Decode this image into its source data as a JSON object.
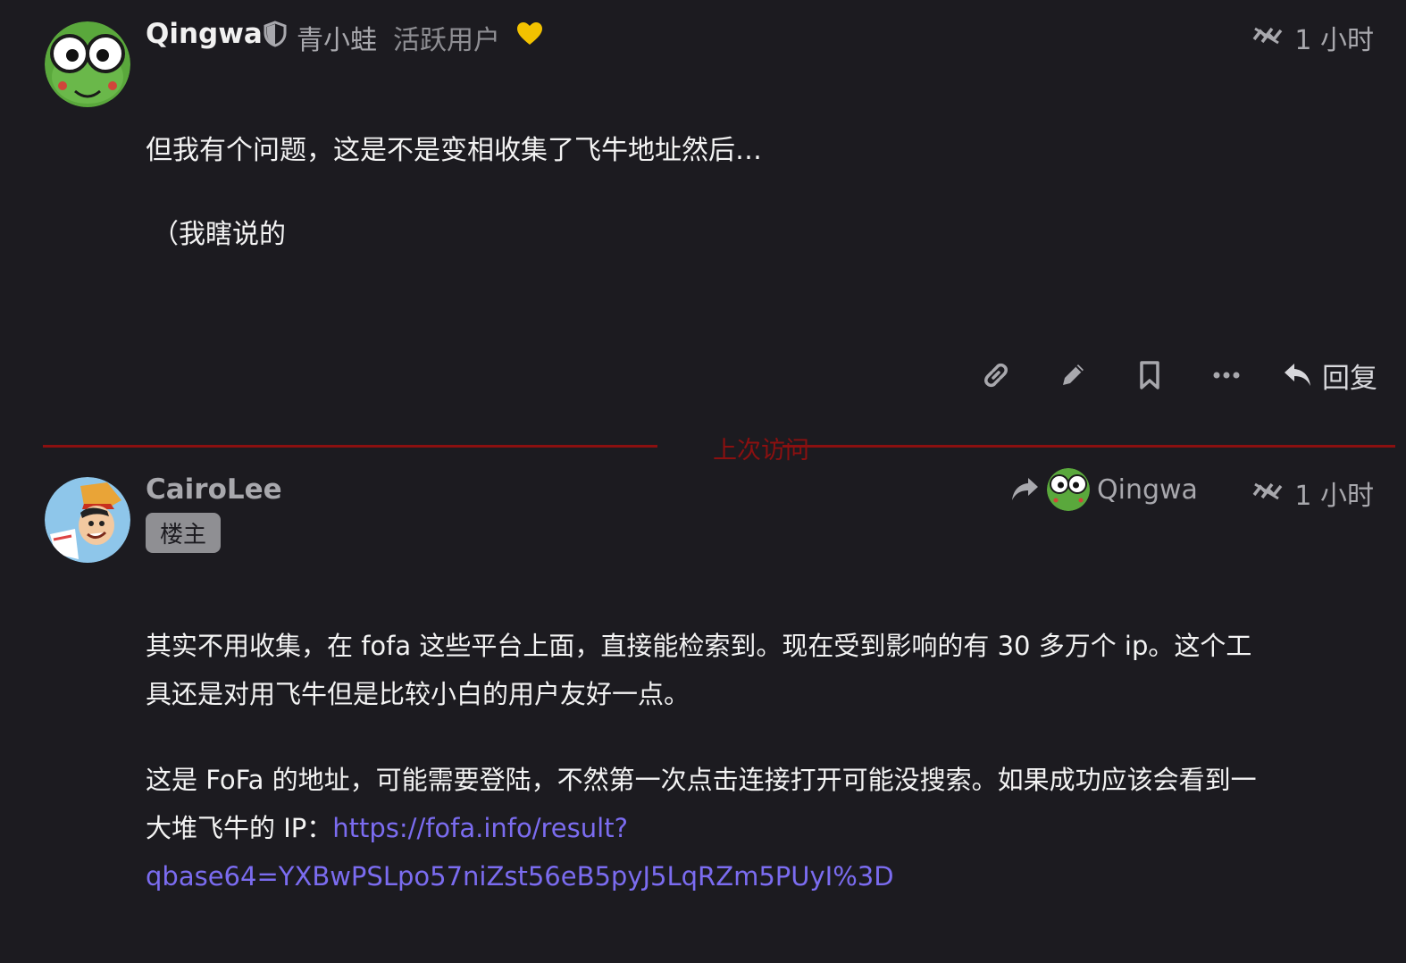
{
  "post1": {
    "username": "Qingwa",
    "display_name": "青小蛙",
    "title": "活跃用户",
    "time": "1 小时",
    "paragraphs": [
      "但我有个问题，这是不是变相收集了飞牛地址然后…",
      "（我瞎说的"
    ],
    "actions": {
      "reply_label": "回复"
    }
  },
  "divider": {
    "label": "上次访问"
  },
  "post2": {
    "username": "CairoLee",
    "badge": "楼主",
    "reply_to": "Qingwa",
    "time": "1 小时",
    "para1_line1": "其实不用收集，在 fofa 这些平台上面，直接能检索到。现在受到影响的有 30 多万个 ip。这个工",
    "para1_line2": "具还是对用飞牛但是比较小白的用户友好一点。",
    "para2_line1": "这是 FoFa 的地址，可能需要登陆，不然第一次点击连接打开可能没搜索。如果成功应该会看到一",
    "para2_line2_prefix": "大堆飞牛的 IP：",
    "link_part1": "https://fofa.info/result?",
    "link_part2": "qbase64=YXBwPSLpo57niZst56eB5pyJ5LqRZm5PUyI%3D"
  },
  "colors": {
    "background": "#1c1b20",
    "divider": "#8b1010",
    "link": "#7b6cf0",
    "heart": "#f2c200"
  }
}
